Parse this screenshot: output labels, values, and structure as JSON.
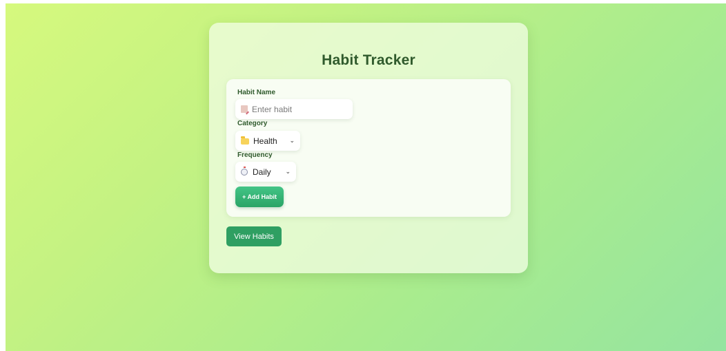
{
  "page": {
    "title": "Habit Tracker"
  },
  "form": {
    "habit_name": {
      "label": "Habit Name",
      "placeholder": "Enter habit",
      "icon": "memo-icon"
    },
    "category": {
      "label": "Category",
      "selected": "Health",
      "icon": "folder-icon"
    },
    "frequency": {
      "label": "Frequency",
      "selected": "Daily",
      "icon": "stopwatch-icon"
    },
    "add_button": "+ Add Habit"
  },
  "view_button": "View Habits",
  "colors": {
    "title": "#2f5a2c",
    "add_button": "#2aa466",
    "view_button": "#2f9f62",
    "background_start": "#d6f97e",
    "background_end": "#95e4a0"
  }
}
